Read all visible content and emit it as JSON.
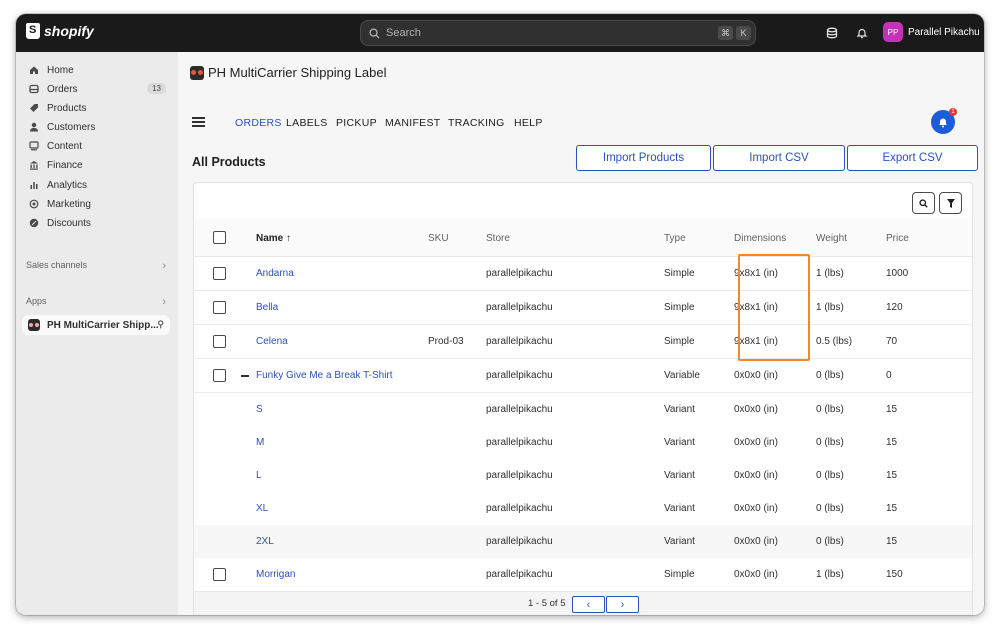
{
  "topbar": {
    "logo_text": "shopify",
    "search_placeholder": "Search",
    "shortcut_keys": [
      "⌘",
      "K"
    ],
    "user_initials": "PP",
    "user_name": "Parallel Pikachu",
    "avatar_color": "#c531b7"
  },
  "sidebar": {
    "items": [
      {
        "label": "Home",
        "icon": "home-icon"
      },
      {
        "label": "Orders",
        "icon": "orders-icon",
        "badge": "13"
      },
      {
        "label": "Products",
        "icon": "tag-icon"
      },
      {
        "label": "Customers",
        "icon": "person-icon"
      },
      {
        "label": "Content",
        "icon": "content-icon"
      },
      {
        "label": "Finance",
        "icon": "bank-icon"
      },
      {
        "label": "Analytics",
        "icon": "bar-chart-icon"
      },
      {
        "label": "Marketing",
        "icon": "target-icon"
      },
      {
        "label": "Discounts",
        "icon": "discount-icon"
      }
    ],
    "sales_channels_label": "Sales channels",
    "apps_label": "Apps",
    "app_item_label": "PH MultiCarrier Shipp..."
  },
  "app": {
    "title": "PH MultiCarrier Shipping Label",
    "tabs": [
      "ORDERS",
      "LABELS",
      "PICKUP",
      "MANIFEST",
      "TRACKING",
      "HELP"
    ],
    "active_tab": "ORDERS",
    "notification_count": "1",
    "page_heading": "All Products",
    "buttons": {
      "import_products": "Import Products",
      "import_csv": "Import CSV",
      "export_csv": "Export CSV"
    },
    "accent_color": "#2c4fc4",
    "highlight_color": "#ef8a2c"
  },
  "table": {
    "headers": {
      "name": "Name ↑",
      "sku": "SKU",
      "store": "Store",
      "type": "Type",
      "dimensions": "Dimensions",
      "weight": "Weight",
      "price": "Price"
    },
    "rows": [
      {
        "name": "Andarna",
        "sku": "",
        "store": "parallelpikachu",
        "type": "Simple",
        "dimensions": "9x8x1 (in)",
        "weight": "1 (lbs)",
        "price": "1000",
        "checkbox": true
      },
      {
        "name": "Bella",
        "sku": "",
        "store": "parallelpikachu",
        "type": "Simple",
        "dimensions": "9x8x1 (in)",
        "weight": "1 (lbs)",
        "price": "120",
        "checkbox": true
      },
      {
        "name": "Celena",
        "sku": "Prod-03",
        "store": "parallelpikachu",
        "type": "Simple",
        "dimensions": "9x8x1 (in)",
        "weight": "0.5 (lbs)",
        "price": "70",
        "checkbox": true
      },
      {
        "name": "Funky Give Me a Break T-Shirt",
        "sku": "",
        "store": "parallelpikachu",
        "type": "Variable",
        "dimensions": "0x0x0 (in)",
        "weight": "0 (lbs)",
        "price": "0",
        "checkbox": true,
        "collapse": true
      },
      {
        "name": "S",
        "sku": "",
        "store": "parallelpikachu",
        "type": "Variant",
        "dimensions": "0x0x0 (in)",
        "weight": "0 (lbs)",
        "price": "15"
      },
      {
        "name": "M",
        "sku": "",
        "store": "parallelpikachu",
        "type": "Variant",
        "dimensions": "0x0x0 (in)",
        "weight": "0 (lbs)",
        "price": "15"
      },
      {
        "name": "L",
        "sku": "",
        "store": "parallelpikachu",
        "type": "Variant",
        "dimensions": "0x0x0 (in)",
        "weight": "0 (lbs)",
        "price": "15"
      },
      {
        "name": "XL",
        "sku": "",
        "store": "parallelpikachu",
        "type": "Variant",
        "dimensions": "0x0x0 (in)",
        "weight": "0 (lbs)",
        "price": "15"
      },
      {
        "name": "2XL",
        "sku": "",
        "store": "parallelpikachu",
        "type": "Variant",
        "dimensions": "0x0x0 (in)",
        "weight": "0 (lbs)",
        "price": "15"
      },
      {
        "name": "Morrigan",
        "sku": "",
        "store": "parallelpikachu",
        "type": "Simple",
        "dimensions": "0x0x0 (in)",
        "weight": "1 (lbs)",
        "price": "150",
        "checkbox": true
      }
    ],
    "pagination_text": "1 - 5 of 5"
  }
}
